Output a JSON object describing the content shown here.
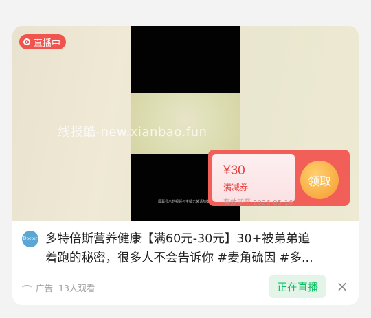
{
  "feed": {
    "live_badge": "直播中",
    "watermark": "线报酷-new.xianbao.fun",
    "video_caption": "屏幕显示的视频与主播无关请勿模仿",
    "coupon": {
      "amount": "¥30",
      "condition": "满减券",
      "validity": "有效期至 2026-05-16",
      "claim_label": "领取"
    },
    "brand_avatar_text": "Doctor BEST",
    "title_line1": "多特倍斯营养健康【满60元-30元】30+被弟弟追",
    "title_line2": "着跑的秘密，很多人不会告诉你 #麦角硫因 #多...",
    "ad_label": "广告",
    "viewers": "13人观看",
    "live_button": "正在直播",
    "close_icon": "×"
  },
  "colors": {
    "live_red": "#f0544f",
    "coupon_red": "#f15f58",
    "claim_orange": "#f8a83e",
    "live_green": "#07c160"
  }
}
